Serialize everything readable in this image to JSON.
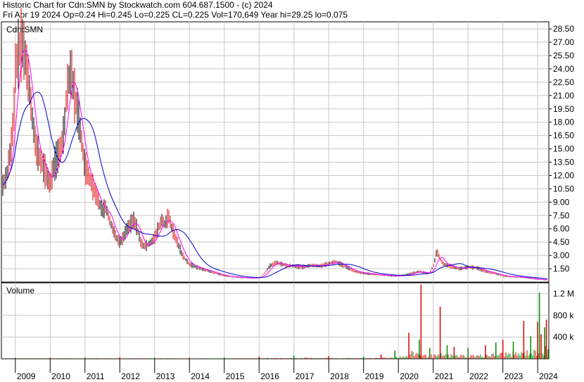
{
  "header": {
    "line1": "Historic Chart for Cdn:SMN by Stockwatch.com 604.687.1500 - (c) 2024",
    "line2": "Fri Apr 19 2024   Op=0.24   Hi=0.245   Lo=0.225   CL=0.225   Vol=170,649   Year hi=29.25   lo=0.075"
  },
  "colors": {
    "background": "#ffffff",
    "grid": "#c8c8c8",
    "up_bar": "#000000",
    "down_bar": "#dd0000",
    "ma_short": "#ff00ff",
    "ma_long": "#0000cc",
    "volume_up": "#008800",
    "volume_down": "#dd0000"
  },
  "chart_data": [
    {
      "type": "line",
      "title": "Cdn:SMN",
      "description_series": "price bars with two moving averages",
      "x_ticks": [
        "2009",
        "2010",
        "2011",
        "2012",
        "2013",
        "2014",
        "2015",
        "2016",
        "2017",
        "2018",
        "2019",
        "2020",
        "2021",
        "2022",
        "2023",
        "2024"
      ],
      "y_ticks": [
        "1.50",
        "3.00",
        "4.50",
        "6.00",
        "7.50",
        "9.00",
        "10.50",
        "12.00",
        "13.50",
        "15.00",
        "16.50",
        "18.00",
        "19.50",
        "21.00",
        "22.50",
        "24.00",
        "25.50",
        "27.00",
        "28.50"
      ],
      "ylim": [
        0,
        29.3
      ],
      "grid": true,
      "series": [
        {
          "name": "",
          "x": [
            2008.5,
            2008.75,
            2008.83,
            2008.9,
            2008.96,
            2009.0,
            2009.1,
            2009.2,
            2009.3,
            2009.4,
            2009.5,
            2009.6,
            2009.7,
            2009.8,
            2009.9,
            2010.0,
            2010.1,
            2010.2,
            2010.3,
            2010.4,
            2010.45,
            2010.5,
            2010.6,
            2010.7,
            2010.8,
            2010.9,
            2011.0,
            2011.1,
            2011.2,
            2011.3,
            2011.4,
            2011.5,
            2011.6,
            2011.7,
            2011.8,
            2011.9,
            2012.0,
            2012.1,
            2012.2,
            2012.3,
            2012.4,
            2012.5,
            2012.6,
            2012.7,
            2012.8,
            2012.9,
            2013.0,
            2013.1,
            2013.2,
            2013.3,
            2013.4,
            2013.5,
            2013.6,
            2013.7,
            2013.8,
            2013.9,
            2014.0,
            2014.25,
            2014.5,
            2014.75,
            2015.0,
            2015.5,
            2015.8,
            2016.0,
            2016.1,
            2016.2,
            2016.3,
            2016.5,
            2016.75,
            2017.0,
            2017.25,
            2017.5,
            2017.75,
            2018.0,
            2018.2,
            2018.5,
            2018.75,
            2019.0,
            2019.5,
            2019.8,
            2020.0,
            2020.2,
            2020.4,
            2020.6,
            2020.8,
            2020.9,
            2021.0,
            2021.05,
            2021.1,
            2021.2,
            2021.3,
            2021.5,
            2021.75,
            2022.0,
            2022.25,
            2022.5,
            2022.75,
            2023.0,
            2023.25,
            2023.5,
            2023.75,
            2024.0,
            2024.3
          ],
          "y": [
            9.5,
            12,
            14,
            16,
            19,
            24,
            26,
            27,
            25,
            22,
            18,
            15,
            14,
            13,
            12,
            11,
            13,
            14,
            15,
            17,
            20,
            22,
            24,
            21,
            19,
            16,
            13,
            12,
            11,
            10,
            9,
            8,
            8.5,
            7,
            6,
            5,
            4.5,
            5,
            6,
            6.5,
            7,
            6,
            4.5,
            4,
            4.2,
            4.5,
            5,
            6,
            7,
            6.5,
            7.5,
            6,
            5,
            4,
            3,
            2.5,
            2,
            1.6,
            1.3,
            1,
            0.7,
            0.5,
            0.45,
            0.5,
            0.8,
            1.2,
            1.8,
            2.2,
            1.9,
            1.8,
            1.7,
            1.9,
            1.8,
            2.1,
            2.3,
            1.7,
            1.2,
            1,
            0.8,
            0.7,
            0.7,
            0.8,
            1,
            1.2,
            1,
            1,
            1.8,
            2.5,
            3.5,
            2.6,
            2,
            1.8,
            1.5,
            1.7,
            1.6,
            1.2,
            1,
            0.7,
            0.6,
            0.55,
            0.45,
            0.3,
            0.22
          ]
        }
      ]
    },
    {
      "type": "bar",
      "title": "Volume",
      "y_ticks": [
        "400 k",
        "800 k",
        "1.2 M"
      ],
      "ylim": [
        0,
        1400000
      ],
      "grid": true,
      "x_ticks": [
        "2009",
        "2010",
        "2011",
        "2012",
        "2013",
        "2014",
        "2015",
        "2016",
        "2017",
        "2018",
        "2019",
        "2020",
        "2021",
        "2022",
        "2023",
        "2024"
      ],
      "series": [
        {
          "name": "",
          "x": [
            2009.0,
            2010.0,
            2011.0,
            2012.0,
            2013.0,
            2014.0,
            2015.0,
            2016.0,
            2017.0,
            2018.0,
            2019.0,
            2019.5,
            2019.9,
            2020.3,
            2020.6,
            2020.65,
            2020.9,
            2021.2,
            2021.4,
            2021.6,
            2022.0,
            2022.5,
            2022.8,
            2023.0,
            2023.3,
            2023.6,
            2023.8,
            2024.0,
            2024.05,
            2024.1,
            2024.2,
            2024.25,
            2024.3
          ],
          "values": [
            20000,
            20000,
            25000,
            30000,
            20000,
            20000,
            25000,
            40000,
            60000,
            50000,
            40000,
            80000,
            150000,
            480000,
            350000,
            1370000,
            200000,
            960000,
            250000,
            220000,
            200000,
            250000,
            300000,
            350000,
            320000,
            700000,
            420000,
            680000,
            1220000,
            450000,
            580000,
            720000,
            170649
          ]
        }
      ]
    }
  ]
}
